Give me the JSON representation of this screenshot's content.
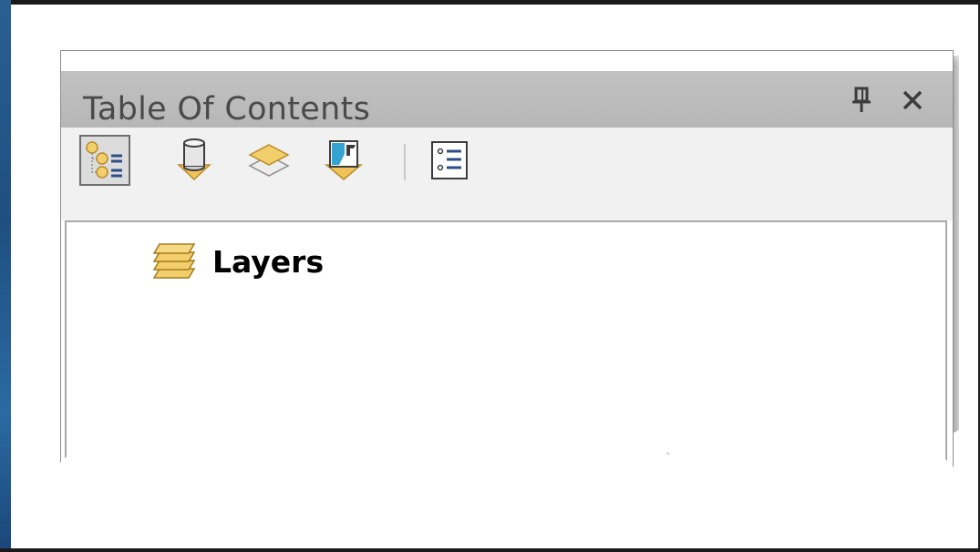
{
  "window": {
    "title": "Table Of Contents"
  },
  "icons": {
    "pin": "pin-icon",
    "close": "close-icon",
    "list_by_drawing_order": "list-by-drawing-order-icon",
    "list_by_source": "list-by-source-icon",
    "list_by_visibility": "list-by-visibility-icon",
    "list_by_selection": "list-by-selection-icon",
    "options": "options-icon",
    "layers": "layers-icon"
  },
  "tree": {
    "root_label": "Layers"
  },
  "colors": {
    "title_bar": "#b9b9b9",
    "toolbar": "#f1f1f1",
    "icon_gold": "#e8b84a",
    "icon_blue": "#3aa0c8"
  }
}
